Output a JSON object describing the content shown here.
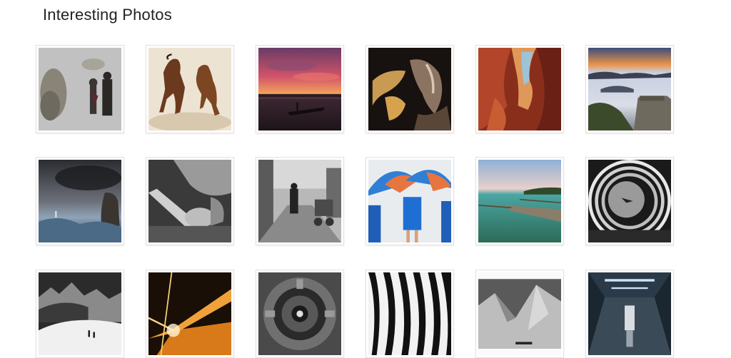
{
  "page": {
    "title": "Interesting Photos"
  },
  "photos": [
    {
      "subject": "reflection-couple-umbrella"
    },
    {
      "subject": "rearing-horses"
    },
    {
      "subject": "sunset-lake-boat"
    },
    {
      "subject": "canyon-rock-dark"
    },
    {
      "subject": "antelope-canyon"
    },
    {
      "subject": "misty-mountains-fort"
    },
    {
      "subject": "storm-sea-lighthouse"
    },
    {
      "subject": "bw-hands-tool"
    },
    {
      "subject": "bw-street-market"
    },
    {
      "subject": "blue-orange-umbrellas"
    },
    {
      "subject": "tropical-boat-water"
    },
    {
      "subject": "spiral-building-plane"
    },
    {
      "subject": "snowy-mountain-hikers"
    },
    {
      "subject": "tunnel-light-trails"
    },
    {
      "subject": "bw-engine-turbine"
    },
    {
      "subject": "zebra-stripes"
    },
    {
      "subject": "bw-mountain-caravan"
    },
    {
      "subject": "metro-station-hall"
    }
  ]
}
